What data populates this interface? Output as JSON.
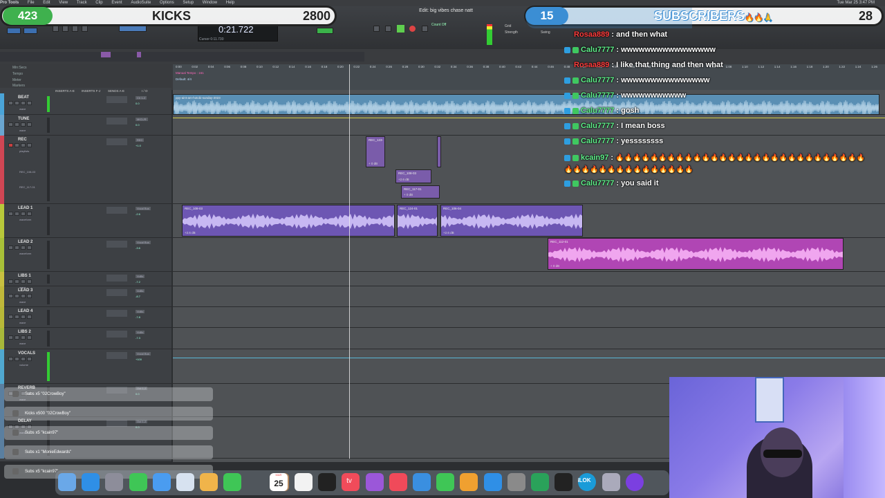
{
  "menubar": {
    "items": [
      "Pro Tools",
      "File",
      "Edit",
      "View",
      "Track",
      "Clip",
      "Event",
      "AudioSuite",
      "Options",
      "Setup",
      "Window",
      "Help"
    ],
    "clock": "Tue Mar 25 3:47 PM"
  },
  "toolbar": {
    "edit_title": "Edit: big vibes chase natt",
    "counter_value": "0:21.722",
    "counter_sub": "Cursor  0:11.730",
    "count_off_label": "Count Off",
    "grid_label": "Grid",
    "nudge_label": "Nudge",
    "strength_label": "Strength",
    "swing_label": "Swing"
  },
  "overlay": {
    "kicks_count": "423",
    "kicks_label": "KICKS",
    "kicks_goal": "2800",
    "subs_count": "15",
    "subs_label": "SUBSCRIBERS",
    "subs_emoji": "🔥🔥🙏",
    "subs_goal": "28"
  },
  "rulers": {
    "labels": [
      "Min:Secs",
      "Tempo",
      "Meter",
      "Markers"
    ],
    "tempo_label": "Manual Tempo : 161",
    "meter_label": "Default: 4/4",
    "ticks": [
      "0:00",
      "0:02",
      "0:04",
      "0:06",
      "0:08",
      "0:10",
      "0:12",
      "0:14",
      "0:16",
      "0:18",
      "0:20",
      "0:22",
      "0:24",
      "0:26",
      "0:28",
      "0:30",
      "0:32",
      "0:34",
      "0:36",
      "0:38",
      "0:40",
      "0:42",
      "0:44",
      "0:46",
      "0:48",
      "0:50",
      "0:52",
      "0:54",
      "0:56",
      "0:58",
      "1:00",
      "1:02",
      "1:04",
      "1:06",
      "1:08",
      "1:10",
      "1:12",
      "1:14",
      "1:16",
      "1:18",
      "1:20",
      "1:22",
      "1:24",
      "1:26"
    ]
  },
  "columns": {
    "inserts_ae": "INSERTS A-E",
    "inserts_fj": "INSERTS F-J",
    "sends_ae": "SENDS A-E",
    "io": "I / O"
  },
  "tracks": [
    {
      "name": "BEAT",
      "color": "#4aa4d8",
      "sub": "wave",
      "send": "Ch 1-2",
      "vol": "0.0"
    },
    {
      "name": "TUNE",
      "color": "#6aa6d0",
      "sub": "wave",
      "send": "MICL/R",
      "vol": "0.0"
    },
    {
      "name": "REC",
      "color": "#d04654",
      "sub": "playlists",
      "send": "REC",
      "vol": "+1.0",
      "extra": [
        "REC_108-03",
        "REC_117-01"
      ]
    },
    {
      "name": "LEAD 1",
      "color": "#b8c83a",
      "sub": "waveform",
      "send": "Vocal Bus",
      "vol": "-2.6"
    },
    {
      "name": "LEAD 2",
      "color": "#a8c038",
      "sub": "waveform",
      "send": "Vocal Bus",
      "vol": "-3.6"
    },
    {
      "name": "LIBS 1",
      "color": "#c8c040",
      "sub": "wave",
      "send": "VoBs",
      "vol": "-7.2"
    },
    {
      "name": "LEAD 3",
      "color": "#c0b83a",
      "sub": "wave",
      "send": "VoBs",
      "vol": "-8.7"
    },
    {
      "name": "LEAD 4",
      "color": "#b8b838",
      "sub": "wave",
      "send": "VoBs",
      "vol": "-7.8"
    },
    {
      "name": "LIBS 2",
      "color": "#a8b83a",
      "sub": "wave",
      "send": "VoBs",
      "vol": "-7.3"
    },
    {
      "name": "VOCALS",
      "color": "#50a8d0",
      "sub": "volume",
      "send": "Vocal Bus",
      "vol": "+100"
    },
    {
      "name": "REVERB",
      "color": "#5a7fa0",
      "sub": "wave",
      "send": "Out 1-2",
      "vol": "0.0"
    },
    {
      "name": "DELAY",
      "color": "#5a7fa0",
      "sub": "wave",
      "send": "Out 1-2",
      "vol": "0.0"
    }
  ],
  "clips": {
    "beat": {
      "name": "ppy-aint-am-hotcbi-sunday-2023",
      "gain": ""
    },
    "rec_a": {
      "name": "REC_123-",
      "gain": "+ 0 dB"
    },
    "rec_b": {
      "name": "REC_108-03",
      "gain": "+2.6 dB"
    },
    "rec_c": {
      "name": "REC_117-01",
      "gain": "+ 0 dB"
    },
    "lead1_a": {
      "name": "REC_108-03",
      "gain": "+2.6 dB"
    },
    "lead1_b": {
      "name": "REC_124-01",
      "gain": "+ 0 dB"
    },
    "lead1_c": {
      "name": "REC_106-04",
      "gain": "+2.6 dB"
    },
    "lead2_a": {
      "name": "REC_112-01",
      "gain": "+ 0 dB"
    }
  },
  "chat": [
    {
      "user": "Rosaa889",
      "user_color": "#ff3b3b",
      "text": "and then what",
      "badge": false
    },
    {
      "user": "Calu7777",
      "user_color": "#5ff08a",
      "text": "wwwwwwwwwwwwwwww",
      "badge": true
    },
    {
      "user": "Rosaa889",
      "user_color": "#ff3b3b",
      "text": "I like that thing and then what",
      "badge": false
    },
    {
      "user": "Calu7777",
      "user_color": "#5ff08a",
      "text": "wwwwwwwwwwwwwww",
      "badge": true
    },
    {
      "user": "Calu7777",
      "user_color": "#5ff08a",
      "text": "wwwwwwwwwww",
      "badge": true
    },
    {
      "user": "Calu7777",
      "user_color": "#5ff08a",
      "text": "gosh",
      "badge": true
    },
    {
      "user": "Calu7777",
      "user_color": "#5ff08a",
      "text": "I mean boss",
      "badge": true
    },
    {
      "user": "Calu7777",
      "user_color": "#5ff08a",
      "text": "yessssssss",
      "badge": true
    },
    {
      "user": "kcain97",
      "user_color": "#5ff08a",
      "text": "🔥🔥🔥🔥🔥🔥🔥🔥🔥🔥🔥🔥🔥🔥🔥🔥🔥🔥🔥🔥🔥🔥🔥🔥🔥🔥🔥🔥🔥🔥🔥🔥🔥🔥🔥🔥🔥🔥🔥🔥🔥🔥🔥🔥",
      "badge": true
    },
    {
      "user": "Calu7777",
      "user_color": "#5ff08a",
      "text": "you said it",
      "badge": true
    }
  ],
  "notifications": [
    "Subs x5 \"02CrowBoy\"",
    "Kicks x500 \"02CrowBoy\"",
    "Subs x5 \"kcain97\"",
    "Subs x1 \"MonieEdwards\"",
    "Subs x5 \"kcain97\""
  ],
  "dock": {
    "month": "MAR",
    "day": "25",
    "tv_label": "tv",
    "ilok_label": "iLOK",
    "apps": [
      "finder-icon",
      "safari-icon",
      "launchpad-icon",
      "messages-icon",
      "mail-icon",
      "preview-icon",
      "photos-icon",
      "facetime-icon",
      "date-icon",
      "contacts-icon",
      "reminders-icon",
      "appletv-icon",
      "music-icon",
      "podcasts-icon",
      "news-icon",
      "keynote-icon",
      "numbers-icon",
      "pages-icon",
      "appstore-icon",
      "systemprefs-icon",
      "guitar-icon",
      "ilok-icon",
      "circle-app-icon",
      "disk-icon",
      "protools-icon"
    ]
  }
}
